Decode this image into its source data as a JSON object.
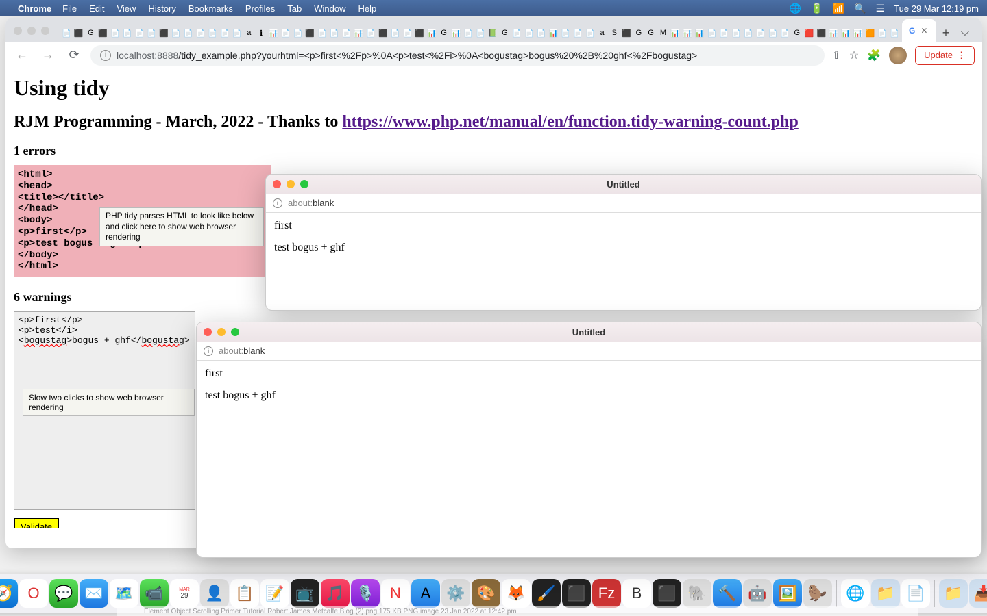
{
  "menubar": {
    "app": "Chrome",
    "items": [
      "File",
      "Edit",
      "View",
      "History",
      "Bookmarks",
      "Profiles",
      "Tab",
      "Window",
      "Help"
    ],
    "clock": "Tue 29 Mar  12:19 pm"
  },
  "toolbar": {
    "url_host": "localhost",
    "url_port": ":8888",
    "url_path": "/tidy_example.php?yourhtml=<p>first<%2Fp>%0A<p>test<%2Fi>%0A<bogustag>bogus%20%2B%20ghf<%2Fbogustag>",
    "update_label": "Update"
  },
  "active_tab": {
    "favicon": "G"
  },
  "page": {
    "h1": "Using tidy",
    "h2_prefix": "RJM Programming - March, 2022 - Thanks to ",
    "h2_link": "https://www.php.net/manual/en/function.tidy-warning-count.php",
    "errors_heading": "1 errors",
    "code_lines": [
      "<html>",
      "<head>",
      "<title></title>",
      "</head>",
      "<body>",
      "<p>first</p>",
      "<p>test bogus + ghf</p>",
      "</body>",
      "</html>"
    ],
    "tooltip1": "PHP tidy parses HTML to look like below and click here to show web browser rendering",
    "warnings_heading": "6 warnings",
    "textarea_lines": [
      "<p>first</p>",
      "<p>test</i>",
      "<bogustag>bogus + ghf</bogustag>"
    ],
    "tooltip2": "Slow two clicks to show web browser rendering",
    "validate_label": "Validate"
  },
  "popup1": {
    "title": "Untitled",
    "url_label": "about:",
    "url_path": "blank",
    "p1": "first",
    "p2": "test bogus + ghf"
  },
  "popup2": {
    "title": "Untitled",
    "url_label": "about:",
    "url_path": "blank",
    "p1": "first",
    "p2": "test bogus + ghf"
  },
  "finder_peek": "Element Object Scrolling Primer Tutorial   Robert James Metcalfe Blog (2).png        175 KB   PNG image        23 Jan 2022 at 12:42 pm"
}
